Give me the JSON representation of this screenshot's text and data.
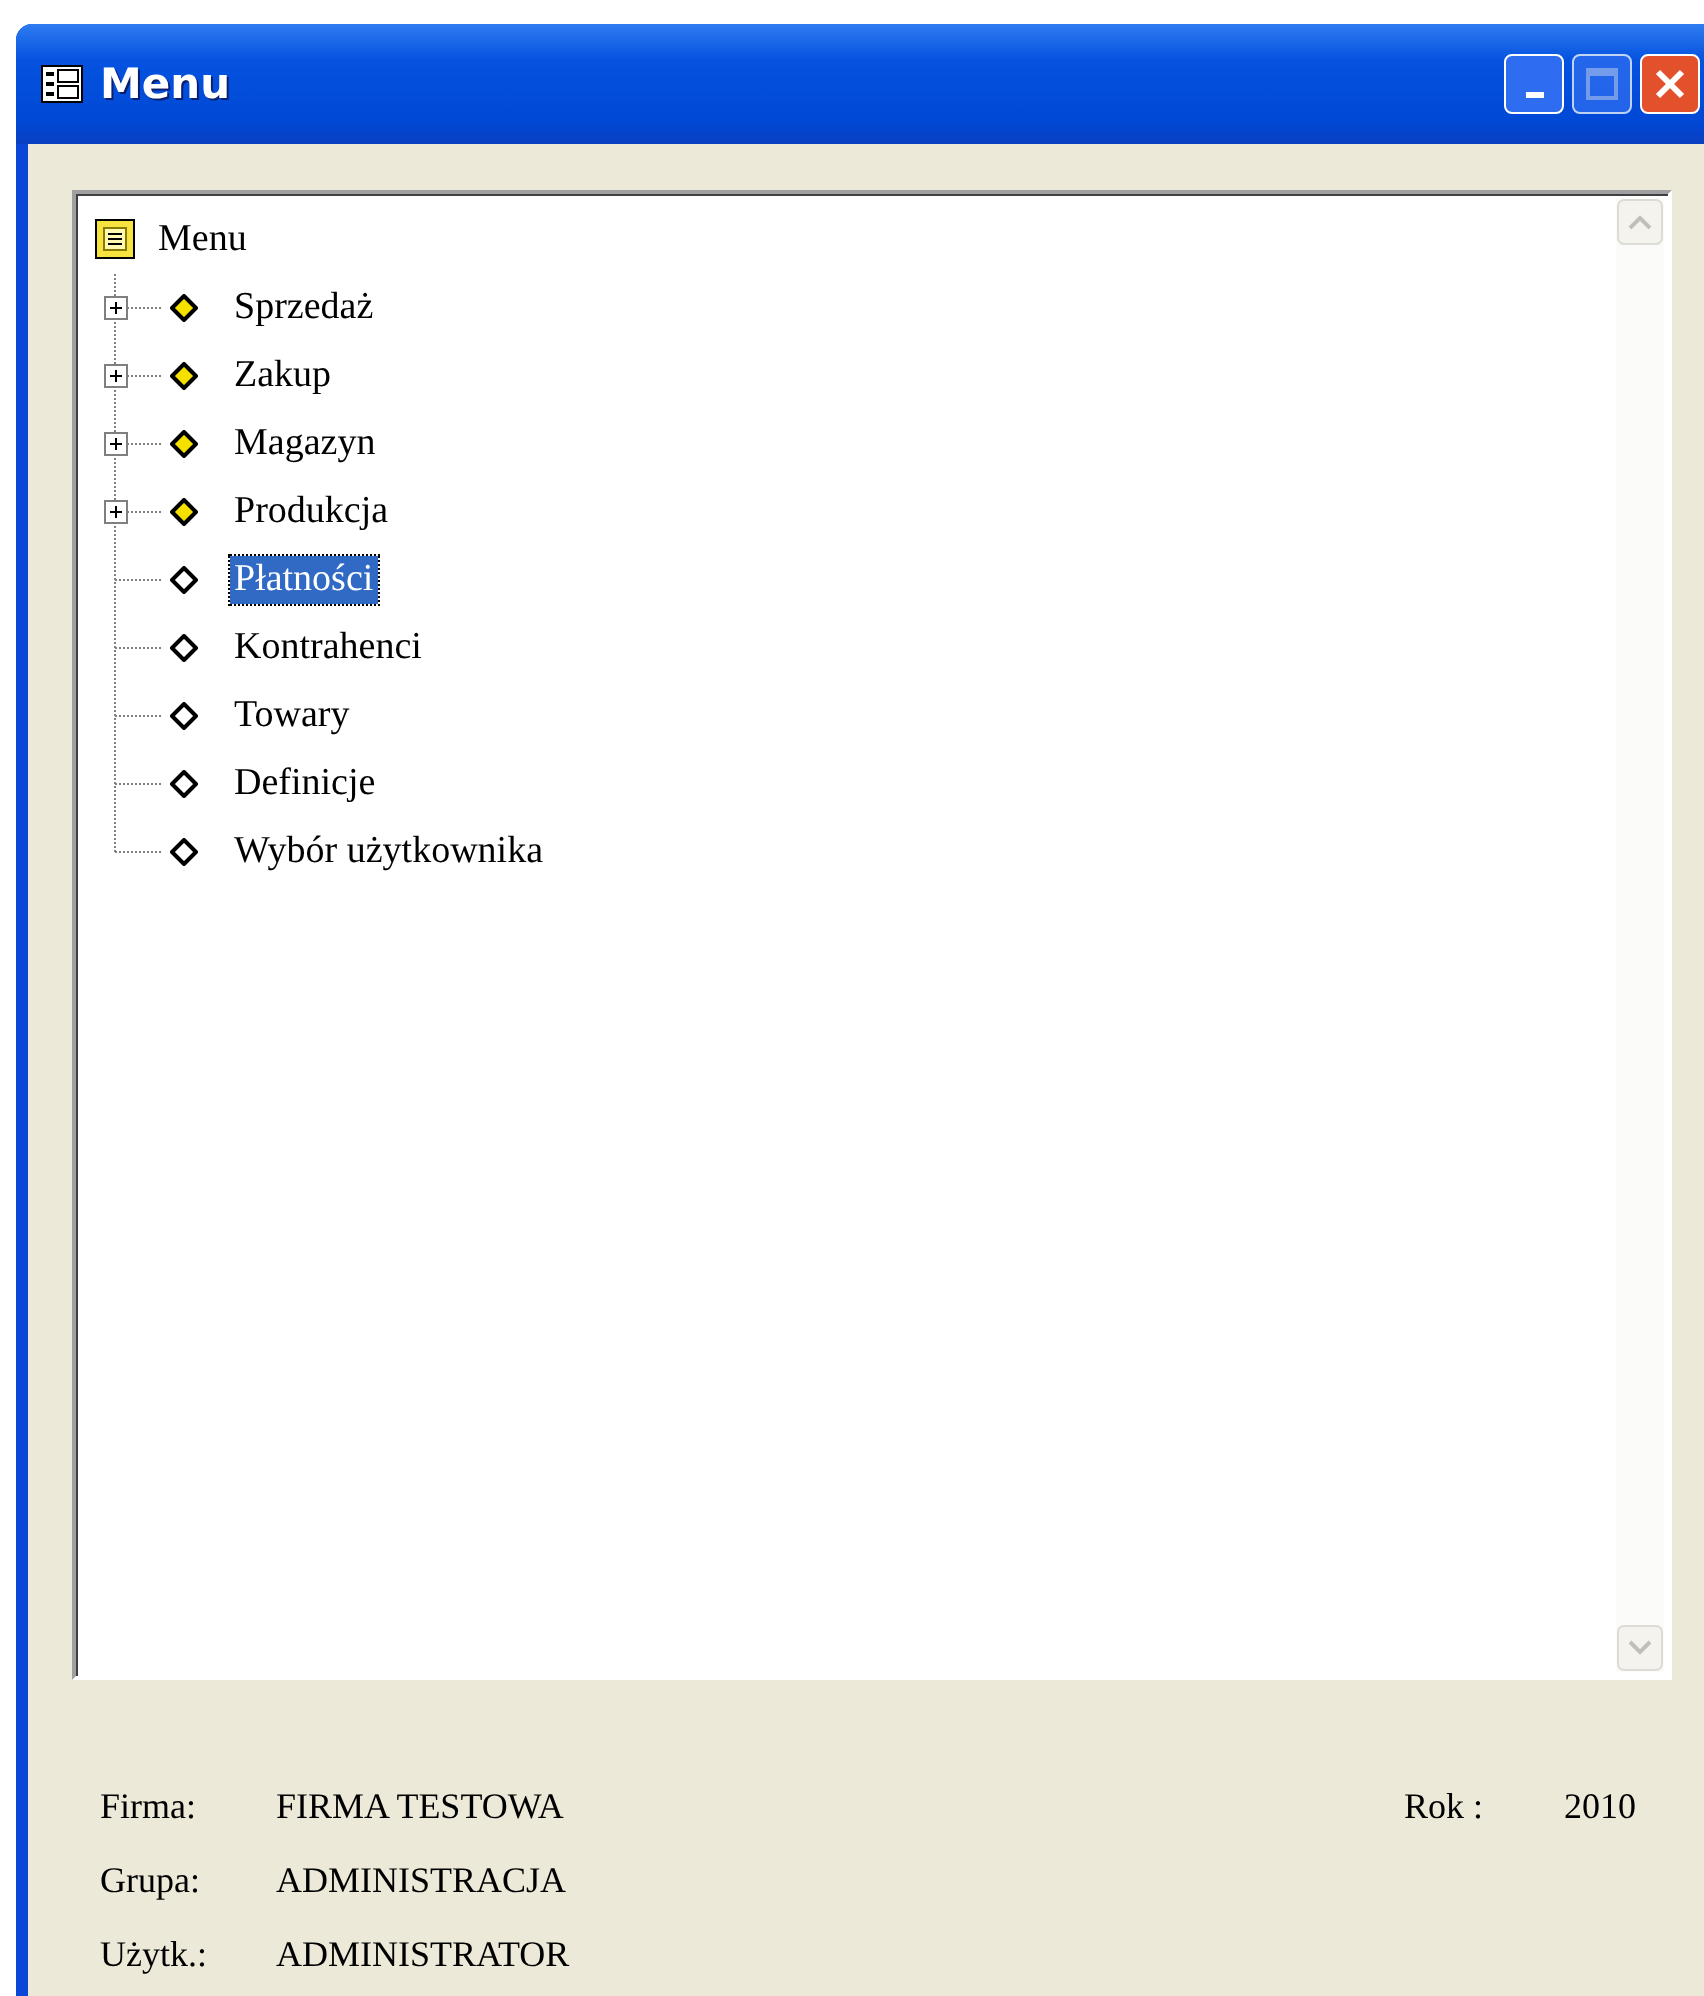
{
  "window": {
    "title": "Menu"
  },
  "tree": {
    "label": "Menu",
    "children": [
      {
        "label": "Sprzedaż",
        "kind": "group",
        "expanded": false,
        "selected": false
      },
      {
        "label": "Zakup",
        "kind": "group",
        "expanded": false,
        "selected": false
      },
      {
        "label": "Magazyn",
        "kind": "group",
        "expanded": false,
        "selected": false
      },
      {
        "label": "Produkcja",
        "kind": "group",
        "expanded": false,
        "selected": false
      },
      {
        "label": "Płatności",
        "kind": "item",
        "selected": true
      },
      {
        "label": "Kontrahenci",
        "kind": "item",
        "selected": false
      },
      {
        "label": "Towary",
        "kind": "item",
        "selected": false
      },
      {
        "label": "Definicje",
        "kind": "item",
        "selected": false
      },
      {
        "label": "Wybór użytkownika",
        "kind": "item",
        "selected": false
      }
    ]
  },
  "footer": {
    "rows": [
      {
        "label": "Firma:",
        "value": "FIRMA TESTOWA",
        "extra_label": "Rok :",
        "extra_value": "2010"
      },
      {
        "label": "Grupa:",
        "value": "ADMINISTRACJA"
      },
      {
        "label": "Użytk.:",
        "value": "ADMINISTRATOR"
      }
    ]
  }
}
